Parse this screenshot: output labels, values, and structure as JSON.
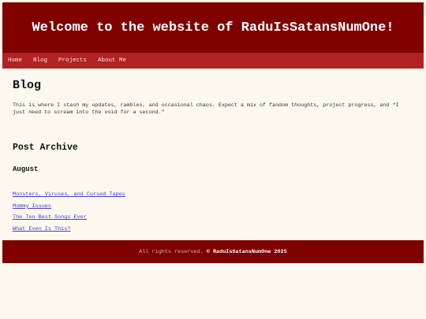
{
  "header": {
    "title": "Welcome to the website of RaduIsSatansNumOne!"
  },
  "nav": {
    "items": [
      "Home",
      "Blog",
      "Projects",
      "About Me"
    ]
  },
  "main": {
    "title": "Blog",
    "intro": "This is where I stash my updates, rambles, and occasional chaos. Expect a mix of fandom thoughts, project progress, and “I just need to scream into the void for a second.”",
    "archive_title": "Post Archive",
    "month": "August",
    "posts": [
      "Monsters, Viruses, and Cursed Tapes",
      "Mommy Issues",
      "The Ten Best Songs Ever",
      "What Even Is This?"
    ]
  },
  "footer": {
    "text": "All rights reserved.",
    "copyright": "© RaduIsSatansNumOne 2025"
  },
  "colors": {
    "header_bg": "#800000",
    "nav_bg": "#b22222",
    "page_bg": "#fdf8ee",
    "link": "#3b3bd6"
  }
}
